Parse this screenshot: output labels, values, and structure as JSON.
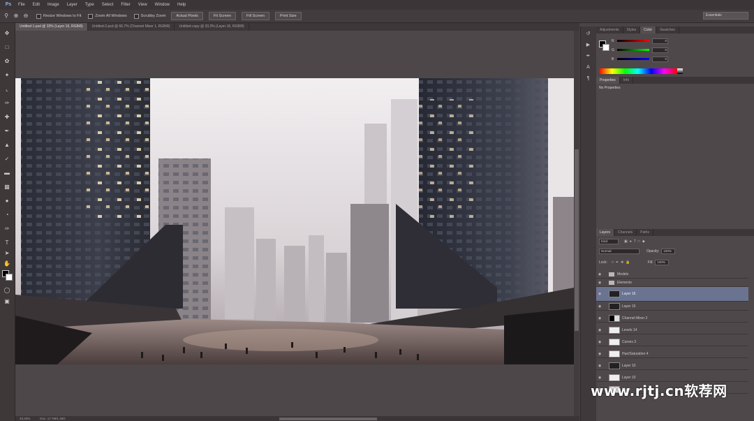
{
  "app": {
    "logo": "Ps"
  },
  "menu": [
    "File",
    "Edit",
    "Image",
    "Layer",
    "Type",
    "Select",
    "Filter",
    "View",
    "Window",
    "Help"
  ],
  "options_bar": {
    "checks": [
      "Resize Windows to Fit",
      "Zoom All Windows",
      "Scrubby Zoom"
    ],
    "buttons": [
      "Actual Pixels",
      "Fit Screen",
      "Fill Screen",
      "Print Size"
    ],
    "workspace": "Essentials"
  },
  "doc_tabs": [
    "Untitled-1.psd @ 33% (Layer 16, RGB/8)",
    "Untitled-2.psd @ 66.7% (Channel Mixer 1, RGB/8)",
    "Untitled-copy @ 33.3% (Layer 16, RGB/8)"
  ],
  "panels": {
    "color_tabs": [
      "Adjustments",
      "Styles",
      "Color",
      "Swatches"
    ],
    "color_active": 2,
    "color_channels": [
      {
        "label": "R",
        "value": "0"
      },
      {
        "label": "G",
        "value": "0"
      },
      {
        "label": "B",
        "value": "0"
      }
    ],
    "props_tabs": [
      "Properties",
      "Info"
    ],
    "props_active": 0,
    "props_title": "No Properties",
    "layers_tabs": [
      "Layers",
      "Channels",
      "Paths"
    ],
    "layers_active": 0,
    "kind_label": "Kind",
    "blend_mode": "Normal",
    "opacity_label": "Opacity:",
    "opacity_value": "100%",
    "lock_label": "Lock:",
    "fill_label": "Fill:",
    "fill_value": "100%",
    "layers": [
      {
        "name": "Models",
        "type": "folder"
      },
      {
        "name": "Elements",
        "type": "folder"
      },
      {
        "name": "Layer 16",
        "type": "dark",
        "selected": true
      },
      {
        "name": "Layer 15",
        "type": "dark"
      },
      {
        "name": "Channel Mixer 2",
        "type": "mix"
      },
      {
        "name": "Levels 14",
        "type": "white"
      },
      {
        "name": "Curves 3",
        "type": "white"
      },
      {
        "name": "Hue/Saturation 4",
        "type": "white"
      },
      {
        "name": "Layer 10",
        "type": "dark"
      },
      {
        "name": "Layer 10",
        "type": "white"
      },
      {
        "name": "Mask",
        "type": "white"
      }
    ]
  },
  "status": {
    "zoom": "33.33%",
    "doc": "Doc: 17.7M/1.46G"
  },
  "watermark": "www.rjtj.cn软荐网",
  "colors": {
    "accent_selected": "#6a7490",
    "panel_bg": "#4f484a"
  }
}
